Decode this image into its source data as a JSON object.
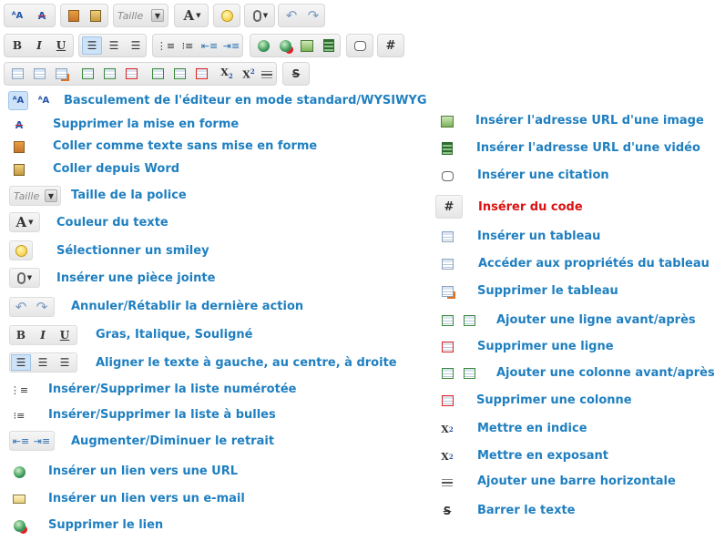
{
  "toolbar": {
    "font_size_select": "Taille",
    "code_symbol": "#",
    "subscript_symbol": "X",
    "subscript_mark": "2",
    "superscript_symbol": "X",
    "superscript_mark": "2",
    "bold_glyph": "B",
    "italic_glyph": "I",
    "underline_glyph": "U",
    "text_color_glyph": "A",
    "strike_glyph": "S"
  },
  "help": {
    "left": [
      "Basculement de l'éditeur en mode standard/WYSIWYG",
      "Supprimer la mise en forme",
      "Coller comme texte sans mise en forme",
      "Coller depuis Word",
      "Taille de la police",
      "Couleur du texte",
      "Sélectionner un smiley",
      "Insérer une pièce jointe",
      "Annuler/Rétablir la dernière action",
      "Gras, Italique, Souligné",
      "Aligner le texte à gauche, au centre, à droite",
      "Insérer/Supprimer la liste numérotée",
      "Insérer/Supprimer la liste à bulles",
      "Augmenter/Diminuer le retrait",
      "Insérer un lien vers une URL",
      "Insérer un lien vers un e-mail",
      "Supprimer le lien"
    ],
    "right": [
      "Insérer l'adresse URL d'une image",
      "Insérer l'adresse URL d'une vidéo",
      "Insérer une citation",
      "Insérer du code",
      "Insérer un tableau",
      "Accéder aux propriétés du tableau",
      "Supprimer le tableau",
      "Ajouter une ligne avant/après",
      "Supprimer une ligne",
      "Ajouter une colonne avant/après",
      "Supprimer une colonne",
      "Mettre en indice",
      "Mettre en exposant",
      "Ajouter une barre horizontale",
      "Barrer le texte"
    ]
  },
  "colors": {
    "label": "#1f7fc0",
    "highlight_label": "#dd1111"
  }
}
